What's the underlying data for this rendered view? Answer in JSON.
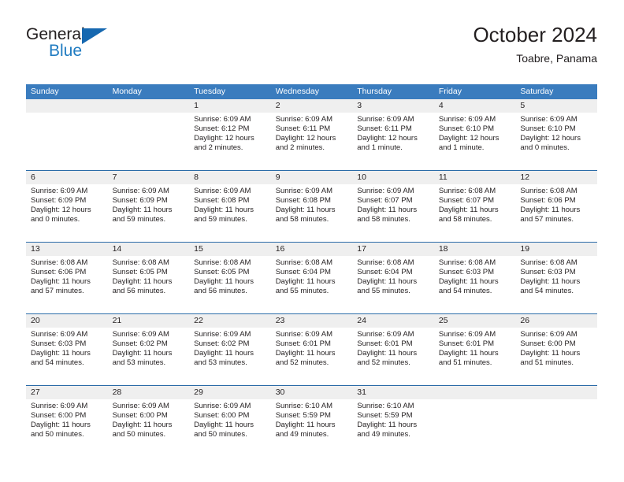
{
  "brand": {
    "word1": "General",
    "word2": "Blue",
    "logo_icon": "blue-triangle-logo",
    "color_primary": "#1668b0",
    "color_text": "#231f20"
  },
  "header": {
    "title": "October 2024",
    "subtitle": "Toabre, Panama"
  },
  "calendar": {
    "header_bg": "#3a7cbe",
    "daynum_bg": "#efefef",
    "grid_line": "#2b6ca8",
    "weekday_headers": [
      "Sunday",
      "Monday",
      "Tuesday",
      "Wednesday",
      "Thursday",
      "Friday",
      "Saturday"
    ],
    "weeks": [
      [
        {
          "day": "",
          "lines": []
        },
        {
          "day": "",
          "lines": []
        },
        {
          "day": "1",
          "lines": [
            "Sunrise: 6:09 AM",
            "Sunset: 6:12 PM",
            "Daylight: 12 hours",
            "and 2 minutes."
          ]
        },
        {
          "day": "2",
          "lines": [
            "Sunrise: 6:09 AM",
            "Sunset: 6:11 PM",
            "Daylight: 12 hours",
            "and 2 minutes."
          ]
        },
        {
          "day": "3",
          "lines": [
            "Sunrise: 6:09 AM",
            "Sunset: 6:11 PM",
            "Daylight: 12 hours",
            "and 1 minute."
          ]
        },
        {
          "day": "4",
          "lines": [
            "Sunrise: 6:09 AM",
            "Sunset: 6:10 PM",
            "Daylight: 12 hours",
            "and 1 minute."
          ]
        },
        {
          "day": "5",
          "lines": [
            "Sunrise: 6:09 AM",
            "Sunset: 6:10 PM",
            "Daylight: 12 hours",
            "and 0 minutes."
          ]
        }
      ],
      [
        {
          "day": "6",
          "lines": [
            "Sunrise: 6:09 AM",
            "Sunset: 6:09 PM",
            "Daylight: 12 hours",
            "and 0 minutes."
          ]
        },
        {
          "day": "7",
          "lines": [
            "Sunrise: 6:09 AM",
            "Sunset: 6:09 PM",
            "Daylight: 11 hours",
            "and 59 minutes."
          ]
        },
        {
          "day": "8",
          "lines": [
            "Sunrise: 6:09 AM",
            "Sunset: 6:08 PM",
            "Daylight: 11 hours",
            "and 59 minutes."
          ]
        },
        {
          "day": "9",
          "lines": [
            "Sunrise: 6:09 AM",
            "Sunset: 6:08 PM",
            "Daylight: 11 hours",
            "and 58 minutes."
          ]
        },
        {
          "day": "10",
          "lines": [
            "Sunrise: 6:09 AM",
            "Sunset: 6:07 PM",
            "Daylight: 11 hours",
            "and 58 minutes."
          ]
        },
        {
          "day": "11",
          "lines": [
            "Sunrise: 6:08 AM",
            "Sunset: 6:07 PM",
            "Daylight: 11 hours",
            "and 58 minutes."
          ]
        },
        {
          "day": "12",
          "lines": [
            "Sunrise: 6:08 AM",
            "Sunset: 6:06 PM",
            "Daylight: 11 hours",
            "and 57 minutes."
          ]
        }
      ],
      [
        {
          "day": "13",
          "lines": [
            "Sunrise: 6:08 AM",
            "Sunset: 6:06 PM",
            "Daylight: 11 hours",
            "and 57 minutes."
          ]
        },
        {
          "day": "14",
          "lines": [
            "Sunrise: 6:08 AM",
            "Sunset: 6:05 PM",
            "Daylight: 11 hours",
            "and 56 minutes."
          ]
        },
        {
          "day": "15",
          "lines": [
            "Sunrise: 6:08 AM",
            "Sunset: 6:05 PM",
            "Daylight: 11 hours",
            "and 56 minutes."
          ]
        },
        {
          "day": "16",
          "lines": [
            "Sunrise: 6:08 AM",
            "Sunset: 6:04 PM",
            "Daylight: 11 hours",
            "and 55 minutes."
          ]
        },
        {
          "day": "17",
          "lines": [
            "Sunrise: 6:08 AM",
            "Sunset: 6:04 PM",
            "Daylight: 11 hours",
            "and 55 minutes."
          ]
        },
        {
          "day": "18",
          "lines": [
            "Sunrise: 6:08 AM",
            "Sunset: 6:03 PM",
            "Daylight: 11 hours",
            "and 54 minutes."
          ]
        },
        {
          "day": "19",
          "lines": [
            "Sunrise: 6:08 AM",
            "Sunset: 6:03 PM",
            "Daylight: 11 hours",
            "and 54 minutes."
          ]
        }
      ],
      [
        {
          "day": "20",
          "lines": [
            "Sunrise: 6:09 AM",
            "Sunset: 6:03 PM",
            "Daylight: 11 hours",
            "and 54 minutes."
          ]
        },
        {
          "day": "21",
          "lines": [
            "Sunrise: 6:09 AM",
            "Sunset: 6:02 PM",
            "Daylight: 11 hours",
            "and 53 minutes."
          ]
        },
        {
          "day": "22",
          "lines": [
            "Sunrise: 6:09 AM",
            "Sunset: 6:02 PM",
            "Daylight: 11 hours",
            "and 53 minutes."
          ]
        },
        {
          "day": "23",
          "lines": [
            "Sunrise: 6:09 AM",
            "Sunset: 6:01 PM",
            "Daylight: 11 hours",
            "and 52 minutes."
          ]
        },
        {
          "day": "24",
          "lines": [
            "Sunrise: 6:09 AM",
            "Sunset: 6:01 PM",
            "Daylight: 11 hours",
            "and 52 minutes."
          ]
        },
        {
          "day": "25",
          "lines": [
            "Sunrise: 6:09 AM",
            "Sunset: 6:01 PM",
            "Daylight: 11 hours",
            "and 51 minutes."
          ]
        },
        {
          "day": "26",
          "lines": [
            "Sunrise: 6:09 AM",
            "Sunset: 6:00 PM",
            "Daylight: 11 hours",
            "and 51 minutes."
          ]
        }
      ],
      [
        {
          "day": "27",
          "lines": [
            "Sunrise: 6:09 AM",
            "Sunset: 6:00 PM",
            "Daylight: 11 hours",
            "and 50 minutes."
          ]
        },
        {
          "day": "28",
          "lines": [
            "Sunrise: 6:09 AM",
            "Sunset: 6:00 PM",
            "Daylight: 11 hours",
            "and 50 minutes."
          ]
        },
        {
          "day": "29",
          "lines": [
            "Sunrise: 6:09 AM",
            "Sunset: 6:00 PM",
            "Daylight: 11 hours",
            "and 50 minutes."
          ]
        },
        {
          "day": "30",
          "lines": [
            "Sunrise: 6:10 AM",
            "Sunset: 5:59 PM",
            "Daylight: 11 hours",
            "and 49 minutes."
          ]
        },
        {
          "day": "31",
          "lines": [
            "Sunrise: 6:10 AM",
            "Sunset: 5:59 PM",
            "Daylight: 11 hours",
            "and 49 minutes."
          ]
        },
        {
          "day": "",
          "lines": []
        },
        {
          "day": "",
          "lines": []
        }
      ]
    ]
  }
}
